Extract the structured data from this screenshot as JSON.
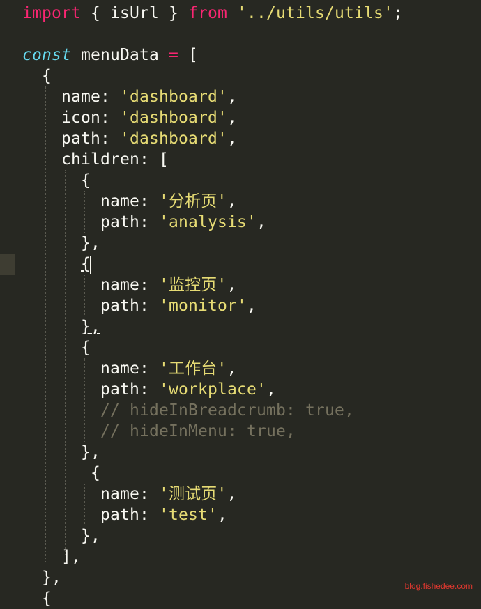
{
  "code": {
    "import_kw": "import",
    "import_open": " { ",
    "import_name": "isUrl",
    "import_close": " } ",
    "from_kw": "from",
    "import_path": "'../utils/utils'",
    "semicolon": ";",
    "const_kw": "const",
    "var_name": " menuData ",
    "equals": "=",
    "bracket_open": " [",
    "obj_open": "{",
    "name_key": "name: ",
    "icon_key": "icon: ",
    "path_key": "path: ",
    "children_key": "children: [",
    "dashboard_str": "'dashboard'",
    "comma": ",",
    "item1_name": "'分析页'",
    "item1_path": "'analysis'",
    "obj_close_comma": "},",
    "item2_name": "'监控页'",
    "item2_path": "'monitor'",
    "item3_name": "'工作台'",
    "item3_path": "'workplace'",
    "comment1_slash": "// ",
    "comment1_text": "hideInBreadcrumb: true,",
    "comment2_text": "hideInMenu: true,",
    "item4_name": "'测试页'",
    "item4_path": "'test'",
    "bracket_close_comma": "],",
    "last_open": "{"
  },
  "watermark": "blog.fishedee.com"
}
